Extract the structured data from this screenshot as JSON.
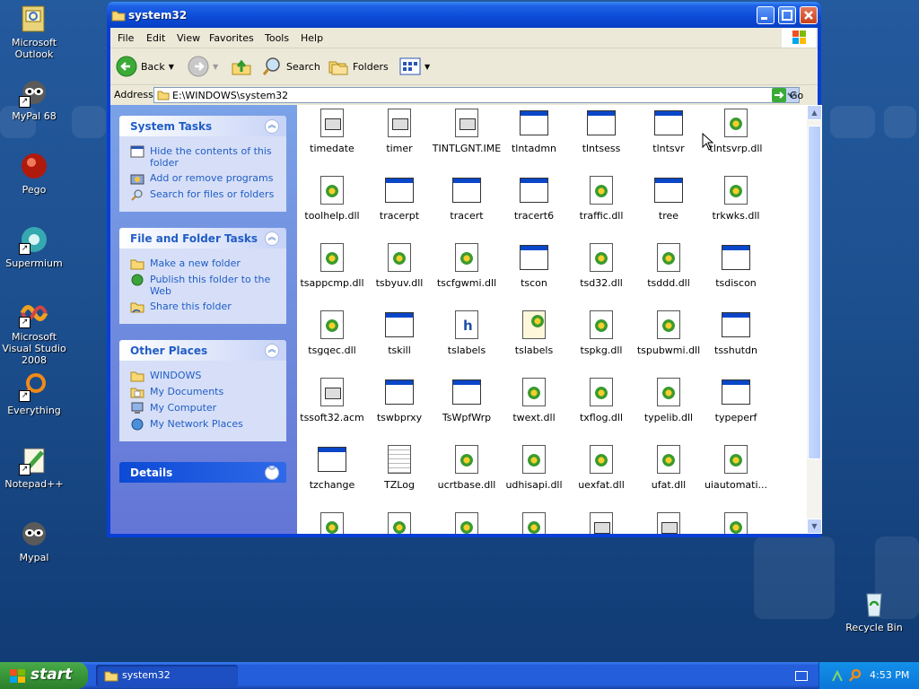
{
  "desktop": {
    "icons": [
      {
        "label": "Microsoft Outlook"
      },
      {
        "label": "MyPal 68"
      },
      {
        "label": "Pego"
      },
      {
        "label": "Supermium"
      },
      {
        "label": "Microsoft Visual Studio 2008"
      },
      {
        "label": "Everything"
      },
      {
        "label": "Notepad++"
      },
      {
        "label": "Mypal"
      }
    ],
    "recycle_bin": "Recycle Bin"
  },
  "window": {
    "title": "system32",
    "menu": [
      "File",
      "Edit",
      "View",
      "Favorites",
      "Tools",
      "Help"
    ],
    "toolbar": {
      "back": "Back",
      "search": "Search",
      "folders": "Folders"
    },
    "address": {
      "label": "Address",
      "value": "E:\\WINDOWS\\system32",
      "go": "Go"
    }
  },
  "taskpane": {
    "system_tasks": {
      "title": "System Tasks",
      "links": [
        "Hide the contents of this folder",
        "Add or remove programs",
        "Search for files or folders"
      ]
    },
    "file_folder_tasks": {
      "title": "File and Folder Tasks",
      "links": [
        "Make a new folder",
        "Publish this folder to the Web",
        "Share this folder"
      ]
    },
    "other_places": {
      "title": "Other Places",
      "links": [
        "WINDOWS",
        "My Documents",
        "My Computer",
        "My Network Places"
      ]
    },
    "details": {
      "title": "Details"
    }
  },
  "files": [
    {
      "name": "timedate",
      "type": "doc-mini"
    },
    {
      "name": "timer",
      "type": "doc-mini"
    },
    {
      "name": "TINTLGNT.IME",
      "type": "doc-mini"
    },
    {
      "name": "tlntadmn",
      "type": "exe"
    },
    {
      "name": "tlntsess",
      "type": "exe"
    },
    {
      "name": "tlntsvr",
      "type": "exe"
    },
    {
      "name": "tlntsvrp.dll",
      "type": "dll"
    },
    {
      "name": "toolhelp.dll",
      "type": "dll"
    },
    {
      "name": "tracerpt",
      "type": "exe"
    },
    {
      "name": "tracert",
      "type": "exe"
    },
    {
      "name": "tracert6",
      "type": "exe"
    },
    {
      "name": "traffic.dll",
      "type": "dll"
    },
    {
      "name": "tree",
      "type": "exe"
    },
    {
      "name": "trkwks.dll",
      "type": "dll"
    },
    {
      "name": "tsappcmp.dll",
      "type": "dll"
    },
    {
      "name": "tsbyuv.dll",
      "type": "dll"
    },
    {
      "name": "tscfgwmi.dll",
      "type": "dll"
    },
    {
      "name": "tscon",
      "type": "exe"
    },
    {
      "name": "tsd32.dll",
      "type": "dll"
    },
    {
      "name": "tsddd.dll",
      "type": "dll"
    },
    {
      "name": "tsdiscon",
      "type": "exe"
    },
    {
      "name": "tsgqec.dll",
      "type": "dll"
    },
    {
      "name": "tskill",
      "type": "exe"
    },
    {
      "name": "tslabels",
      "type": "h"
    },
    {
      "name": "tslabels",
      "type": "ini"
    },
    {
      "name": "tspkg.dll",
      "type": "dll"
    },
    {
      "name": "tspubwmi.dll",
      "type": "dll"
    },
    {
      "name": "tsshutdn",
      "type": "exe"
    },
    {
      "name": "tssoft32.acm",
      "type": "doc-mini"
    },
    {
      "name": "tswbprxy",
      "type": "exe"
    },
    {
      "name": "TsWpfWrp",
      "type": "exe"
    },
    {
      "name": "twext.dll",
      "type": "dll"
    },
    {
      "name": "txflog.dll",
      "type": "dll"
    },
    {
      "name": "typelib.dll",
      "type": "dll"
    },
    {
      "name": "typeperf",
      "type": "exe"
    },
    {
      "name": "tzchange",
      "type": "exe"
    },
    {
      "name": "TZLog",
      "type": "txt"
    },
    {
      "name": "ucrtbase.dll",
      "type": "dll"
    },
    {
      "name": "udhisapi.dll",
      "type": "dll"
    },
    {
      "name": "uexfat.dll",
      "type": "dll"
    },
    {
      "name": "ufat.dll",
      "type": "dll"
    },
    {
      "name": "uiautomati...",
      "type": "dll"
    },
    {
      "name": "",
      "type": "dll"
    },
    {
      "name": "",
      "type": "dll"
    },
    {
      "name": "",
      "type": "dll"
    },
    {
      "name": "",
      "type": "dll"
    },
    {
      "name": "",
      "type": "doc-mini"
    },
    {
      "name": "",
      "type": "doc-mini"
    },
    {
      "name": "",
      "type": "dll"
    }
  ],
  "taskbar": {
    "start": "start",
    "task": "system32",
    "clock": "4:53 PM"
  }
}
